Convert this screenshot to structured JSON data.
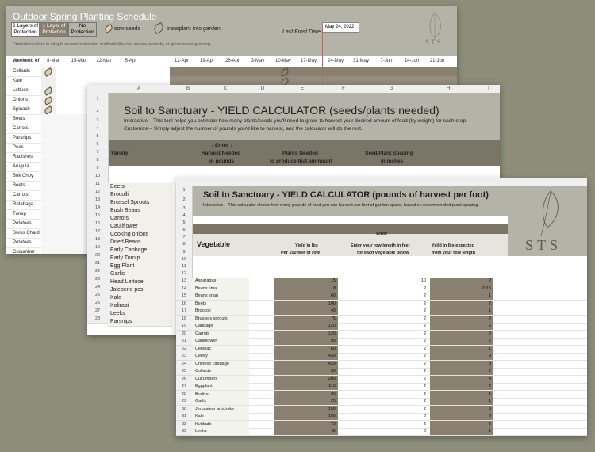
{
  "schedule": {
    "title": "Outdoor Spring Planting Schedule",
    "legend": {
      "layers2": "2 Layers of Protection",
      "layer1": "1 Layer of Protection",
      "none": "No Protection",
      "sow": "sow seeds",
      "transplant": "transplant into garden"
    },
    "last_frost_label": "Last Frost Date >",
    "last_frost_date": "May 24, 2022",
    "note": "Protection refers to simple season extension methods like row covers, tunnels, or greenhouse growing.",
    "weekend_label": "Weekend of:",
    "weeks": [
      "8-Mar",
      "15-Mar",
      "22-Mar",
      "5-Apr",
      "12-Apr",
      "19-Apr",
      "26-Apr",
      "3-May",
      "10-May",
      "17-May",
      "24-May",
      "31-May",
      "7-Jun",
      "14-Jun",
      "21-Jun"
    ],
    "crops": [
      "Collards",
      "Kale",
      "Lettuce",
      "Onions",
      "Spinach",
      "Beets",
      "Carrots",
      "Parsnips",
      "Peas",
      "Radishes",
      "Arugula",
      "Bok Choy",
      "Beets",
      "Carrots",
      "Rutabaga",
      "Turnip",
      "Potatoes",
      "Swiss Chard",
      "Potatoes",
      "Cucumber"
    ],
    "logo_text": "STS"
  },
  "seeds_calc": {
    "columns": [
      "A",
      "B",
      "C",
      "D",
      "E",
      "F",
      "G",
      "H",
      "I"
    ],
    "title": "Soil to Sanctuary - YIELD CALCULATOR (seeds/plants needed)",
    "desc1": "Interactive – This tool helps you estimate how many plants/seeds you'll need to grow, to harvest your desired amount of food (by weight) for each crop.",
    "desc2": "Customize – Simply adjust the number of pounds you'd like to harvest, and the calculator will do the rest.",
    "enter": "↓ Enter ↓",
    "h_variety": "Variety",
    "h_harvest1": "Harvest Needed",
    "h_harvest2": "in pounds",
    "h_plants1": "Plants Needed",
    "h_plants2": "to produce that ammount",
    "h_spacing1": "Seed/Plant Spacing",
    "h_spacing2": "in inches",
    "row_numbers": [
      "1",
      "2",
      "3",
      "4",
      "5",
      "6",
      "7",
      "8",
      "9",
      "10",
      "11",
      "12",
      "13",
      "14",
      "15",
      "16",
      "17",
      "18",
      "19",
      "20",
      "21",
      "22",
      "23",
      "24",
      "25",
      "26",
      "27",
      "28"
    ],
    "varieties": [
      "Beets",
      "Brocolli",
      "Brussel Sprouts",
      "Bush Beans",
      "Carrots",
      "Cauliflower",
      "Cooking onions",
      "Dried Beans",
      "Early Cabbage",
      "Early Turnip",
      "Egg Plant",
      "Garlic",
      "Head Lettuce",
      "Jalepeno pcs",
      "Kale",
      "Kolirabi",
      "Leeks",
      "Parsnips"
    ]
  },
  "foot_calc": {
    "title": "Soil to Sanctuary - YIELD CALCULATOR (pounds of harvest per foot)",
    "subtitle": "Interactive – This calculator shows how many pounds of food you can harvest per foot of garden space, based on recommended plant spacing.",
    "enter": "↓ Enter ↓",
    "h_vegetable": "Vegetable",
    "h_yield1": "Yield in lbs",
    "h_yield2": "Per 100 feet of row",
    "h_row1": "Enter your row length in feet",
    "h_row2": "for each vegetable below",
    "h_exp1": "Yeild in lbs expected",
    "h_exp2": "from your row length",
    "logo_text": "STS",
    "row_numbers": [
      "1",
      "2",
      "3",
      "4",
      "5",
      "6",
      "7",
      "8",
      "9",
      "10",
      "11",
      "12"
    ],
    "rows": [
      {
        "n": "13",
        "veg": "Asparagus",
        "yield": "15",
        "len": "10",
        "exp": "2"
      },
      {
        "n": "14",
        "veg": "Beans lima",
        "yield": "8",
        "len": "2",
        "exp": "0.16"
      },
      {
        "n": "15",
        "veg": "Beans snap",
        "yield": "60",
        "len": "2",
        "exp": "1"
      },
      {
        "n": "16",
        "veg": "Beets",
        "yield": "100",
        "len": "2",
        "exp": "2"
      },
      {
        "n": "17",
        "veg": "Broccoli",
        "yield": "40",
        "len": "2",
        "exp": "1"
      },
      {
        "n": "18",
        "veg": "Brussels sprouts",
        "yield": "75",
        "len": "2",
        "exp": "2"
      },
      {
        "n": "19",
        "veg": "Cabbage",
        "yield": "120",
        "len": "2",
        "exp": "2"
      },
      {
        "n": "20",
        "veg": "Carrots",
        "yield": "120",
        "len": "2",
        "exp": "2"
      },
      {
        "n": "21",
        "veg": "Cauliflower",
        "yield": "90",
        "len": "2",
        "exp": "2"
      },
      {
        "n": "22",
        "veg": "Celeriac",
        "yield": "60",
        "len": "2",
        "exp": "1"
      },
      {
        "n": "23",
        "veg": "Celery",
        "yield": "430",
        "len": "2",
        "exp": "9"
      },
      {
        "n": "24",
        "veg": "Chinese cabbage",
        "yield": "420",
        "len": "2",
        "exp": "8"
      },
      {
        "n": "25",
        "veg": "Collards",
        "yield": "90",
        "len": "2",
        "exp": "2"
      },
      {
        "n": "26",
        "veg": "Cucumbers",
        "yield": "200",
        "len": "2",
        "exp": "4"
      },
      {
        "n": "27",
        "veg": "Eggplant",
        "yield": "115",
        "len": "2",
        "exp": "2"
      },
      {
        "n": "28",
        "veg": "Endive",
        "yield": "55",
        "len": "2",
        "exp": "1"
      },
      {
        "n": "29",
        "veg": "Garlic",
        "yield": "25",
        "len": "2",
        "exp": "1"
      },
      {
        "n": "30",
        "veg": "Jerusalem artichoke",
        "yield": "150",
        "len": "2",
        "exp": "3"
      },
      {
        "n": "31",
        "veg": "Kale",
        "yield": "100",
        "len": "2",
        "exp": "2"
      },
      {
        "n": "32",
        "veg": "Kohlrabi",
        "yield": "75",
        "len": "2",
        "exp": "2"
      },
      {
        "n": "33",
        "veg": "Leeks",
        "yield": "45",
        "len": "2",
        "exp": "1"
      }
    ]
  }
}
